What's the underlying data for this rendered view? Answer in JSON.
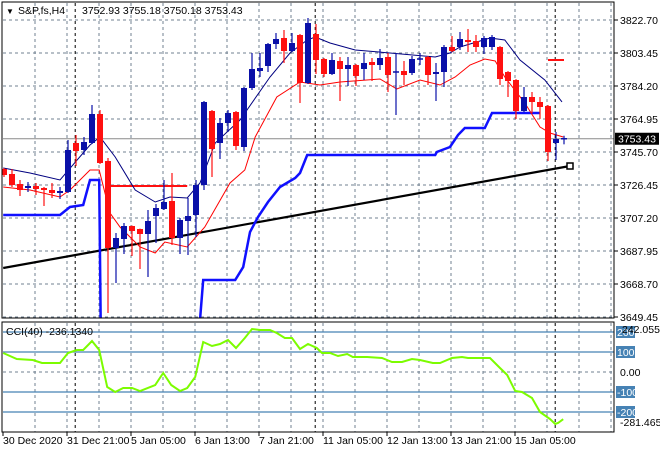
{
  "header": {
    "arrow": "▼",
    "symbol": "S&P,fs,H4",
    "ohlc": "3752.93 3755.18 3750.18 3753.43"
  },
  "cci_label": "CCI(40) -236.1340",
  "colors": {
    "bull": "#0a10a8",
    "bear": "#ff1010",
    "upper_line": "#000080",
    "lower_line": "#ff0000",
    "stop_line": "#1010ff",
    "trend_line": "#000000",
    "cci_line": "#7cfc00",
    "cci_level": "#4682b4",
    "grid": "#708090"
  },
  "chart_data": [
    {
      "type": "candlestick",
      "title": "S&P,fs,H4",
      "ylim": [
        3649.45,
        3822.7
      ],
      "y_ticks": [
        "3822.70",
        "3803.45",
        "3784.20",
        "3764.95",
        "3745.70",
        "3726.45",
        "3707.20",
        "3687.95",
        "3668.70",
        "3649.45"
      ],
      "current_price": "3753.43",
      "x_labels": [
        {
          "bar": 0,
          "label": "30 Dec 2020"
        },
        {
          "bar": 8,
          "label": "31 Dec 21:00"
        },
        {
          "bar": 16,
          "label": "5 Jan 05:00"
        },
        {
          "bar": 24,
          "label": "6 Jan 13:00"
        },
        {
          "bar": 32,
          "label": "7 Jan 21:00"
        },
        {
          "bar": 40,
          "label": "11 Jan 05:00"
        },
        {
          "bar": 48,
          "label": "12 Jan 13:00"
        },
        {
          "bar": 56,
          "label": "13 Jan 21:00"
        },
        {
          "bar": 64,
          "label": "15 Jan 05:00"
        }
      ],
      "period_separators": [
        8.9,
        38.9,
        68.9
      ],
      "ohlc": [
        [
          3735.78,
          3736.37,
          3731.12,
          3732.28
        ],
        [
          3732.87,
          3735.78,
          3725.28,
          3726.45
        ],
        [
          3727.03,
          3729.37,
          3720.03,
          3723.53
        ],
        [
          3724.7,
          3728.2,
          3722.37,
          3725.87
        ],
        [
          3725.87,
          3727.62,
          3720.62,
          3724.12
        ],
        [
          3724.7,
          3725.28,
          3714.2,
          3723.53
        ],
        [
          3723.53,
          3727.62,
          3718.87,
          3721.78
        ],
        [
          3721.78,
          3725.28,
          3718.28,
          3722.95
        ],
        [
          3722.37,
          3752.7,
          3721.78,
          3746.87
        ],
        [
          3750.95,
          3755.62,
          3737.53,
          3746.28
        ],
        [
          3746.87,
          3754.45,
          3743.95,
          3751.53
        ],
        [
          3750.95,
          3773.12,
          3750.37,
          3767.87
        ],
        [
          3767.87,
          3770.2,
          3738.7,
          3739.28
        ],
        [
          3740.45,
          3742.2,
          3651.78,
          3689.7
        ],
        [
          3689.7,
          3698.45,
          3669.28,
          3695.53
        ],
        [
          3694.95,
          3704.28,
          3686.2,
          3702.53
        ],
        [
          3702.53,
          3702.8,
          3685.03,
          3699.62
        ],
        [
          3700.78,
          3701.0,
          3677.45,
          3697.87
        ],
        [
          3697.87,
          3711.87,
          3672.78,
          3705.45
        ],
        [
          3708.37,
          3715.37,
          3692.62,
          3713.03
        ],
        [
          3712.45,
          3729.37,
          3711.87,
          3716.53
        ],
        [
          3717.12,
          3733.45,
          3691.45,
          3695.53
        ],
        [
          3695.53,
          3707.2,
          3686.2,
          3706.03
        ],
        [
          3705.45,
          3718.87,
          3685.62,
          3708.37
        ],
        [
          3708.95,
          3729.37,
          3696.12,
          3726.45
        ],
        [
          3726.45,
          3775.45,
          3723.53,
          3774.87
        ],
        [
          3769.62,
          3770.2,
          3731.12,
          3747.45
        ],
        [
          3750.95,
          3765.53,
          3741.62,
          3762.62
        ],
        [
          3762.62,
          3770.2,
          3757.37,
          3768.45
        ],
        [
          3769.03,
          3769.62,
          3746.87,
          3749.2
        ],
        [
          3748.62,
          3783.62,
          3746.28,
          3783.03
        ],
        [
          3783.03,
          3803.45,
          3781.87,
          3794.12
        ],
        [
          3792.95,
          3803.45,
          3789.45,
          3794.7
        ],
        [
          3795.87,
          3809.28,
          3792.37,
          3808.7
        ],
        [
          3808.7,
          3815.12,
          3805.78,
          3811.62
        ],
        [
          3812.2,
          3816.87,
          3797.62,
          3804.62
        ],
        [
          3804.62,
          3815.12,
          3804.03,
          3809.28
        ],
        [
          3813.95,
          3814.53,
          3774.28,
          3785.95
        ],
        [
          3785.95,
          3823.87,
          3785.37,
          3820.95
        ],
        [
          3814.53,
          3820.37,
          3791.2,
          3799.37
        ],
        [
          3799.95,
          3800.53,
          3789.45,
          3791.2
        ],
        [
          3791.2,
          3803.45,
          3790.62,
          3799.37
        ],
        [
          3798.78,
          3801.12,
          3775.45,
          3794.12
        ],
        [
          3794.12,
          3801.12,
          3784.2,
          3796.45
        ],
        [
          3796.45,
          3797.0,
          3784.2,
          3790.03
        ],
        [
          3794.12,
          3803.45,
          3787.7,
          3797.62
        ],
        [
          3798.2,
          3800.53,
          3787.12,
          3796.45
        ],
        [
          3796.45,
          3805.78,
          3793.53,
          3800.53
        ],
        [
          3801.12,
          3803.45,
          3780.7,
          3790.62
        ],
        [
          3791.78,
          3803.45,
          3767.28,
          3792.37
        ],
        [
          3792.95,
          3798.78,
          3784.78,
          3790.62
        ],
        [
          3791.78,
          3801.7,
          3790.62,
          3799.95
        ],
        [
          3799.37,
          3803.45,
          3796.45,
          3799.95
        ],
        [
          3801.12,
          3801.7,
          3784.78,
          3790.62
        ],
        [
          3791.2,
          3797.62,
          3775.45,
          3792.37
        ],
        [
          3792.37,
          3808.12,
          3783.62,
          3806.95
        ],
        [
          3806.95,
          3813.37,
          3804.03,
          3804.62
        ],
        [
          3806.95,
          3815.7,
          3805.2,
          3811.62
        ],
        [
          3811.03,
          3817.45,
          3804.03,
          3809.87
        ],
        [
          3810.45,
          3813.95,
          3804.03,
          3806.95
        ],
        [
          3806.95,
          3813.37,
          3802.87,
          3812.2
        ],
        [
          3806.95,
          3813.95,
          3805.2,
          3812.78
        ],
        [
          3806.95,
          3807.5,
          3784.78,
          3788.28
        ],
        [
          3792.37,
          3792.9,
          3777.78,
          3787.12
        ],
        [
          3787.7,
          3788.2,
          3764.95,
          3769.62
        ],
        [
          3769.62,
          3783.62,
          3769.03,
          3777.78
        ],
        [
          3777.78,
          3780.7,
          3768.45,
          3774.87
        ],
        [
          3774.87,
          3777.78,
          3765.0,
          3771.95
        ],
        [
          3772.53,
          3773.1,
          3740.45,
          3745.7
        ],
        [
          3750.95,
          3757.37,
          3741.03,
          3753.28
        ],
        [
          3752.93,
          3755.18,
          3750.18,
          3753.43
        ]
      ],
      "upper_band": [
        [
          -0.1,
          3736.37
        ],
        [
          3.25,
          3733.45
        ],
        [
          7,
          3729.37
        ],
        [
          10.75,
          3749.78
        ],
        [
          12,
          3754.45
        ],
        [
          13.9,
          3742.78
        ],
        [
          16.4,
          3723.53
        ],
        [
          18.9,
          3716.53
        ],
        [
          20.75,
          3719.45
        ],
        [
          22.9,
          3718.87
        ],
        [
          24.5,
          3727.62
        ],
        [
          26.4,
          3750.95
        ],
        [
          29.5,
          3764.37
        ],
        [
          33.25,
          3789.45
        ],
        [
          35.75,
          3803.45
        ],
        [
          37.9,
          3811.03
        ],
        [
          38.9,
          3812.78
        ],
        [
          40.75,
          3809.28
        ],
        [
          43.9,
          3805.2
        ],
        [
          48.25,
          3803.45
        ],
        [
          53.9,
          3801.12
        ],
        [
          55.75,
          3803.45
        ],
        [
          57,
          3806.95
        ],
        [
          60.75,
          3812.2
        ],
        [
          62.6,
          3811.03
        ],
        [
          64.5,
          3799.37
        ],
        [
          67.6,
          3787.7
        ],
        [
          69.75,
          3774.87
        ]
      ],
      "lower_band": [
        [
          -0.1,
          3725.28
        ],
        [
          3.25,
          3723.53
        ],
        [
          7,
          3719.45
        ],
        [
          8.25,
          3723.53
        ],
        [
          10.75,
          3735.2
        ],
        [
          11.9,
          3735.2
        ],
        [
          13.25,
          3710.12
        ],
        [
          14.5,
          3701.95
        ],
        [
          17,
          3690.28
        ],
        [
          18.9,
          3686.78
        ],
        [
          20.1,
          3693.2
        ],
        [
          22.9,
          3690.28
        ],
        [
          25.1,
          3701.95
        ],
        [
          28.25,
          3727.62
        ],
        [
          30.1,
          3735.2
        ],
        [
          31.4,
          3754.45
        ],
        [
          34.1,
          3777.78
        ],
        [
          37,
          3786.53
        ],
        [
          39.5,
          3784.78
        ],
        [
          42,
          3786.53
        ],
        [
          47,
          3788.28
        ],
        [
          49.1,
          3782.45
        ],
        [
          52,
          3787.7
        ],
        [
          54.5,
          3784.78
        ],
        [
          56.4,
          3789.45
        ],
        [
          58.25,
          3796.45
        ],
        [
          60.1,
          3799.95
        ],
        [
          61.4,
          3798.78
        ],
        [
          62.6,
          3789.45
        ],
        [
          65.1,
          3774.28
        ],
        [
          67,
          3760.28
        ],
        [
          68.25,
          3756.78
        ],
        [
          69.9,
          3754.45
        ]
      ],
      "stop_line": [
        [
          [
            -0.1,
            3708.95
          ],
          [
            7,
            3708.95
          ],
          [
            8.25,
            3713.62
          ],
          [
            9.9,
            3714.78
          ],
          [
            10.75,
            3729.37
          ],
          [
            11.9,
            3729.37
          ],
          [
            12.1,
            3640.0
          ]
        ],
        [
          [
            24.5,
            3647.7
          ],
          [
            24.9,
            3671.03
          ],
          [
            28.9,
            3671.03
          ],
          [
            29.9,
            3678.62
          ],
          [
            30.75,
            3699.03
          ],
          [
            31.75,
            3707.78
          ],
          [
            33,
            3716.53
          ],
          [
            34.5,
            3725.28
          ],
          [
            36.4,
            3730.53
          ],
          [
            37,
            3733.45
          ],
          [
            37.9,
            3743.95
          ],
          [
            53.9,
            3743.95
          ],
          [
            54.1,
            3745.7
          ],
          [
            55.75,
            3748.62
          ],
          [
            56.75,
            3755.62
          ],
          [
            57.6,
            3759.7
          ],
          [
            60.1,
            3759.7
          ],
          [
            61,
            3768.45
          ],
          [
            67,
            3768.45
          ]
        ]
      ],
      "trend_line": [
        [
          -0.1,
          3678.03
        ],
        [
          70.75,
          3737.53
        ]
      ],
      "horizontal_levels": [
        {
          "from": 12.9,
          "to": 22.9,
          "price": 3725.87
        },
        {
          "from": 68,
          "to": 70,
          "price": 3799.37
        }
      ]
    },
    {
      "type": "line",
      "title": "CCI(40) -236.1340",
      "ylim": [
        -281.4652,
        242.055
      ],
      "max_label": "242.055",
      "min_label": "-281.4652",
      "levels": [
        {
          "value": 200,
          "label": "200",
          "boxed": true
        },
        {
          "value": 100,
          "label": "100",
          "boxed": true
        },
        {
          "value": 0,
          "label": "0.00",
          "boxed": false
        },
        {
          "value": -100,
          "label": "-100",
          "boxed": true
        },
        {
          "value": -200,
          "label": "-200",
          "boxed": true
        }
      ],
      "points": [
        [
          -0.1,
          95
        ],
        [
          1.6,
          65
        ],
        [
          3.6,
          60
        ],
        [
          4.75,
          45
        ],
        [
          7,
          45
        ],
        [
          8,
          95
        ],
        [
          9.1,
          110
        ],
        [
          9.9,
          110
        ],
        [
          11,
          155
        ],
        [
          11.9,
          110
        ],
        [
          12.9,
          -75
        ],
        [
          13.9,
          -100
        ],
        [
          14.9,
          -80
        ],
        [
          16,
          -80
        ],
        [
          17,
          -95
        ],
        [
          18.9,
          -65
        ],
        [
          19.9,
          -5
        ],
        [
          20.9,
          -65
        ],
        [
          22,
          -95
        ],
        [
          22.9,
          -80
        ],
        [
          23.9,
          -25
        ],
        [
          24.9,
          150
        ],
        [
          26,
          130
        ],
        [
          27,
          140
        ],
        [
          28,
          160
        ],
        [
          29,
          120
        ],
        [
          30.1,
          170
        ],
        [
          31,
          215
        ],
        [
          32,
          210
        ],
        [
          33.25,
          210
        ],
        [
          34.1,
          195
        ],
        [
          35.1,
          170
        ],
        [
          36,
          170
        ],
        [
          37,
          115
        ],
        [
          38,
          140
        ],
        [
          39.1,
          120
        ],
        [
          39.75,
          95
        ],
        [
          40.75,
          95
        ],
        [
          41.75,
          80
        ],
        [
          42.9,
          90
        ],
        [
          43.6,
          75
        ],
        [
          45.4,
          75
        ],
        [
          47.25,
          70
        ],
        [
          48.5,
          50
        ],
        [
          49.75,
          50
        ],
        [
          51,
          65
        ],
        [
          52,
          60
        ],
        [
          53.6,
          45
        ],
        [
          54.5,
          45
        ],
        [
          56,
          70
        ],
        [
          57.25,
          75
        ],
        [
          58,
          70
        ],
        [
          60.75,
          70
        ],
        [
          62,
          20
        ],
        [
          62.9,
          -15
        ],
        [
          63.9,
          -95
        ],
        [
          64.75,
          -100
        ],
        [
          66,
          -130
        ],
        [
          67,
          -200
        ],
        [
          68.25,
          -235
        ],
        [
          68.9,
          -260
        ],
        [
          69.25,
          -255
        ],
        [
          69.9,
          -236
        ]
      ]
    }
  ]
}
